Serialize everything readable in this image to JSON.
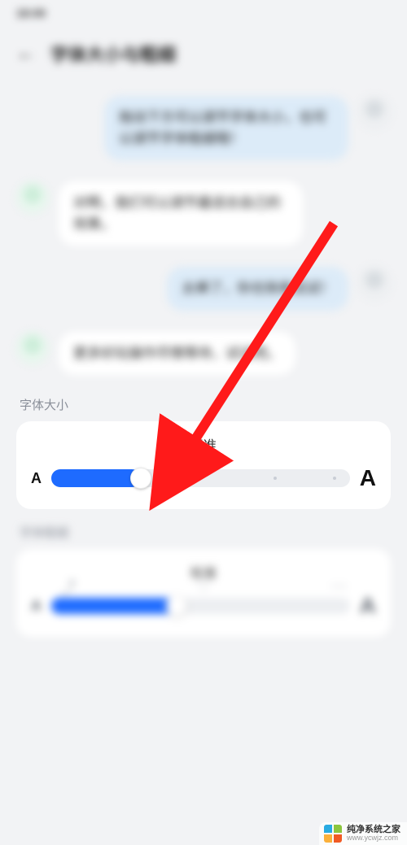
{
  "status": {
    "left": "18:09",
    "right": ""
  },
  "title": "字体大小与粗细",
  "chat": {
    "m1": "拖动下方可以调节字体大小，也可以调节字体粗细哦！",
    "m2": "对啊，我们可以调节最适合自己的效果。",
    "m3": "太棒了，你也快来试试！",
    "m4": "更多好玩操作尽情等待，试试吧。"
  },
  "sections": {
    "font_size": {
      "label": "字体大小",
      "current": "标准",
      "glyph_small": "A",
      "glyph_large": "A",
      "slider": {
        "value_pct": 30,
        "ticks_pct": [
          50,
          75,
          95
        ]
      }
    },
    "font_weight": {
      "label": "字体粗细",
      "current": "标准",
      "glyph_small": "A",
      "glyph_large": "A",
      "slider": {
        "value_pct": 42
      }
    }
  },
  "watermark": {
    "line1": "纯净系统之家",
    "line2": "www.ycwjz.com"
  },
  "colors": {
    "accent": "#1e6bff",
    "arrow": "#ff1a1a"
  }
}
